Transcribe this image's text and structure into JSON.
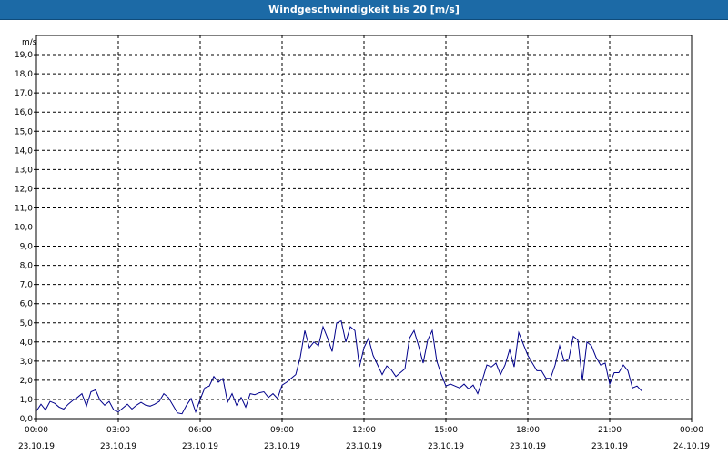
{
  "header": {
    "title": "Windgeschwindigkeit bis 20 [m/s]"
  },
  "chart_data": {
    "type": "line",
    "title": "Windgeschwindigkeit bis 20 [m/s]",
    "ylabel": "m/s",
    "xlabel": "",
    "ylim": [
      0,
      20
    ],
    "grid": true,
    "yticks": [
      "0,0",
      "1,0",
      "2,0",
      "3,0",
      "4,0",
      "5,0",
      "6,0",
      "7,0",
      "8,0",
      "9,0",
      "10,0",
      "11,0",
      "12,0",
      "13,0",
      "14,0",
      "15,0",
      "16,0",
      "17,0",
      "18,0",
      "19,0"
    ],
    "xticks": [
      {
        "time": "00:00",
        "date": "23.10.19"
      },
      {
        "time": "03:00",
        "date": "23.10.19"
      },
      {
        "time": "06:00",
        "date": "23.10.19"
      },
      {
        "time": "09:00",
        "date": "23.10.19"
      },
      {
        "time": "12:00",
        "date": "23.10.19"
      },
      {
        "time": "15:00",
        "date": "23.10.19"
      },
      {
        "time": "18:00",
        "date": "23.10.19"
      },
      {
        "time": "21:00",
        "date": "23.10.19"
      },
      {
        "time": "00:00",
        "date": "24.10.19"
      }
    ],
    "line_color": "#00008b",
    "series": [
      {
        "time": [
          "00:00",
          "00:10",
          "00:20",
          "00:30",
          "00:40",
          "00:50",
          "01:00",
          "01:10",
          "01:20",
          "01:30",
          "01:40",
          "01:50",
          "02:00",
          "02:10",
          "02:20",
          "02:30",
          "02:40",
          "02:50",
          "03:00",
          "03:10",
          "03:20",
          "03:30",
          "03:40",
          "03:50",
          "04:00",
          "04:10",
          "04:20",
          "04:30",
          "04:40",
          "04:50",
          "05:00",
          "05:10",
          "05:20",
          "05:30",
          "05:40",
          "05:50",
          "06:00",
          "06:10",
          "06:20",
          "06:30",
          "06:40",
          "06:50",
          "07:00",
          "07:10",
          "07:20",
          "07:30",
          "07:40",
          "07:50",
          "08:00",
          "08:10",
          "08:20",
          "08:30",
          "08:40",
          "08:50",
          "09:00",
          "09:10",
          "09:20",
          "09:30",
          "09:40",
          "09:50",
          "10:00",
          "10:10",
          "10:20",
          "10:30",
          "10:40",
          "10:50",
          "11:00",
          "11:10",
          "11:20",
          "11:30",
          "11:40",
          "11:50",
          "12:00",
          "12:10",
          "12:20",
          "12:30",
          "12:40",
          "12:50",
          "13:00",
          "13:10",
          "13:20",
          "13:30",
          "13:40",
          "13:50",
          "14:00",
          "14:10",
          "14:20",
          "14:30",
          "14:40",
          "14:50",
          "15:00",
          "15:10",
          "15:20",
          "15:30",
          "15:40",
          "15:50",
          "16:00",
          "16:10",
          "16:20",
          "16:30",
          "16:40",
          "16:50",
          "17:00",
          "17:10",
          "17:20",
          "17:30",
          "17:40",
          "17:50",
          "18:00",
          "18:10",
          "18:20",
          "18:30",
          "18:40",
          "18:50",
          "19:00",
          "19:10",
          "19:20",
          "19:30",
          "19:40",
          "19:50",
          "20:00",
          "20:10",
          "20:20",
          "20:30",
          "20:40",
          "20:50",
          "21:00",
          "21:10",
          "21:20",
          "21:30",
          "21:40",
          "21:50",
          "22:00",
          "22:10",
          "22:20",
          "22:30",
          "22:40",
          "22:50",
          "23:00",
          "23:10",
          "23:20",
          "23:30",
          "23:40",
          "23:50"
        ],
        "values": [
          0.4,
          0.75,
          0.45,
          0.9,
          0.8,
          0.6,
          0.5,
          0.75,
          0.95,
          1.1,
          1.3,
          0.65,
          1.4,
          1.5,
          0.95,
          0.7,
          0.9,
          0.45,
          0.35,
          0.55,
          0.75,
          0.5,
          0.7,
          0.85,
          0.7,
          0.65,
          0.75,
          0.9,
          1.3,
          1.1,
          0.7,
          0.3,
          0.25,
          0.7,
          1.05,
          0.35,
          1.0,
          1.6,
          1.7,
          2.2,
          1.9,
          2.1,
          0.85,
          1.3,
          0.7,
          1.1,
          0.6,
          1.3,
          1.25,
          1.35,
          1.4,
          1.1,
          1.3,
          1.05,
          1.75,
          1.9,
          2.1,
          2.3,
          3.2,
          4.6,
          3.7,
          4.0,
          3.8,
          4.8,
          4.2,
          3.5,
          5.0,
          5.1,
          4.0,
          4.8,
          4.6,
          2.7,
          3.7,
          4.2,
          3.3,
          2.8,
          2.3,
          2.75,
          2.55,
          2.2,
          2.4,
          2.6,
          4.2,
          4.6,
          3.8,
          2.9,
          4.1,
          4.6,
          3.0,
          2.3,
          1.7,
          1.8,
          1.7,
          1.6,
          1.8,
          1.55,
          1.75,
          1.3,
          2.0,
          2.8,
          2.7,
          2.9,
          2.3,
          2.8,
          3.6,
          2.7,
          4.5,
          3.9,
          3.3,
          2.9,
          2.5,
          2.5,
          2.1,
          2.1,
          2.8,
          3.8,
          3.0,
          3.1,
          4.3,
          4.1,
          2.0,
          4.0,
          3.8,
          3.2,
          2.8,
          2.9,
          1.8,
          2.4,
          2.4,
          2.8,
          2.5,
          1.6,
          1.7,
          1.45
        ]
      }
    ]
  }
}
